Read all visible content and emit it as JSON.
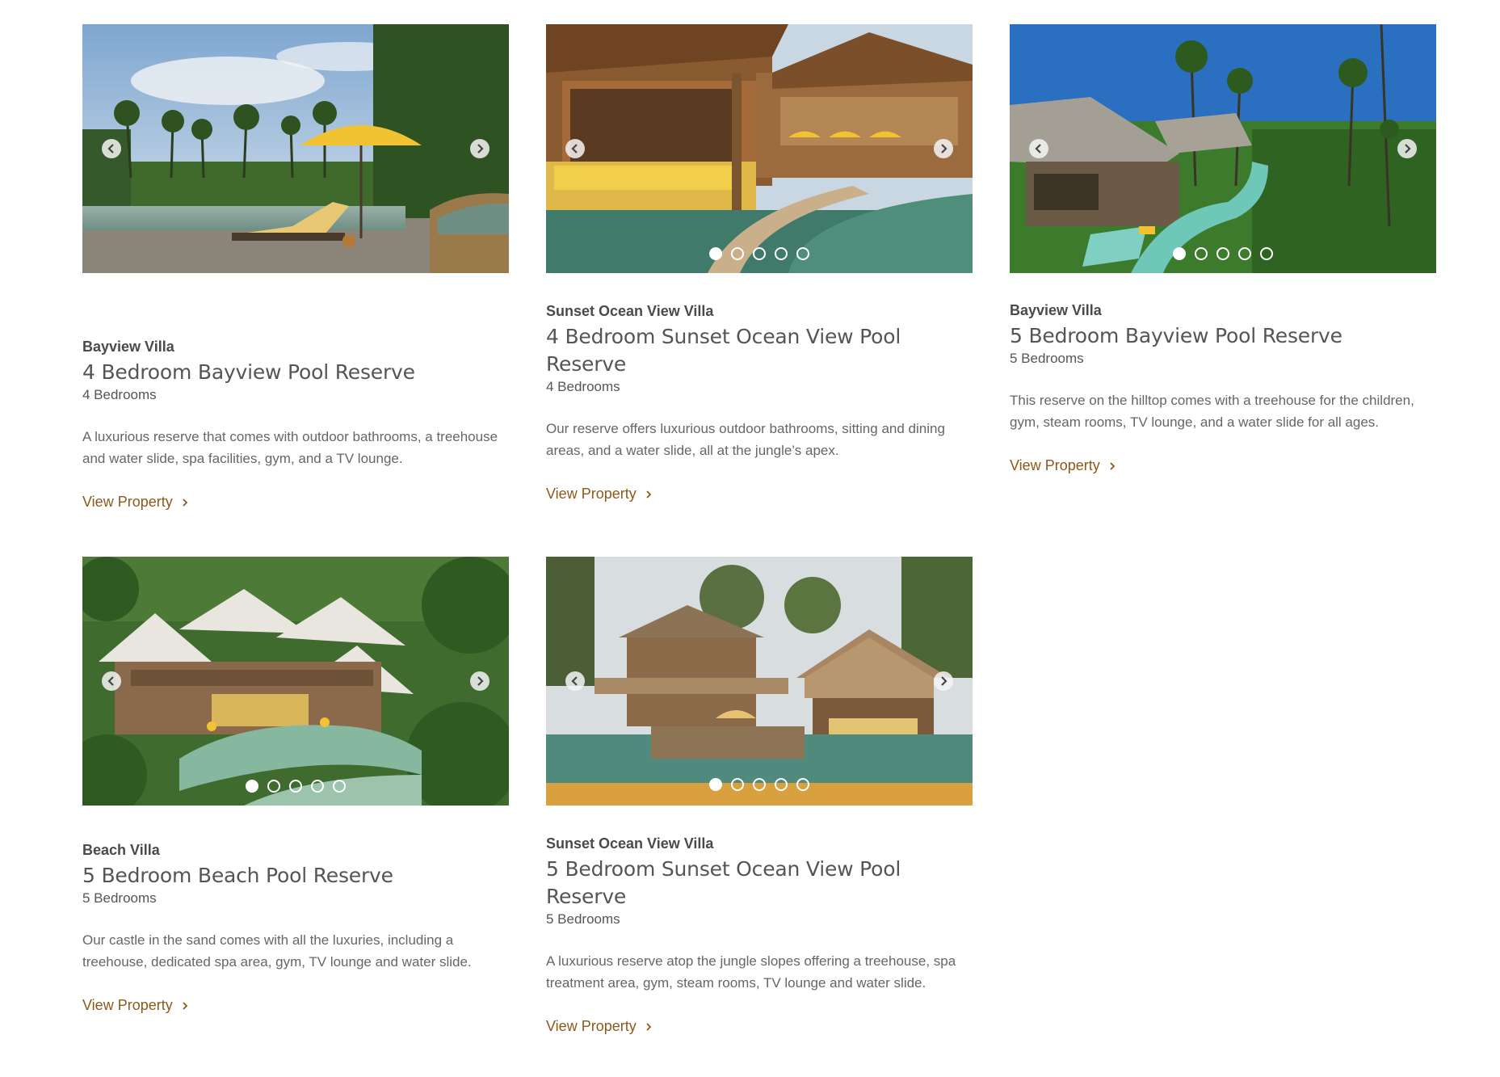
{
  "properties": [
    {
      "category": "Bayview Villa",
      "title": "4 Bedroom Bayview Pool Reserve",
      "bedrooms": "4 Bedrooms",
      "description": "A luxurious reserve that comes with outdoor bathrooms, a treehouse and water slide, spa facilities, gym, and a TV lounge.",
      "link": "View Property",
      "slide_count": 5,
      "active_slide": 1,
      "show_dots": false
    },
    {
      "category": "Sunset Ocean View Villa",
      "title": "4 Bedroom Sunset Ocean View Pool Reserve",
      "bedrooms": "4 Bedrooms",
      "description": "Our reserve offers luxurious outdoor bathrooms, sitting and dining areas, and a water slide, all at the jungle’s apex.",
      "link": "View Property",
      "slide_count": 5,
      "active_slide": 1,
      "show_dots": true
    },
    {
      "category": "Bayview Villa",
      "title": "5 Bedroom Bayview Pool Reserve",
      "bedrooms": "5 Bedrooms",
      "description": "This reserve on the hilltop comes with a treehouse for the children, gym, steam rooms, TV lounge, and a water slide for all ages.",
      "link": "View Property",
      "slide_count": 5,
      "active_slide": 1,
      "show_dots": true
    },
    {
      "category": "Beach Villa",
      "title": "5 Bedroom Beach Pool Reserve",
      "bedrooms": "5 Bedrooms",
      "description": "Our castle in the sand comes with all the luxuries, including a treehouse, dedicated spa area, gym, TV lounge and water slide.",
      "link": "View Property",
      "slide_count": 5,
      "active_slide": 1,
      "show_dots": true
    },
    {
      "category": "Sunset Ocean View Villa",
      "title": "5 Bedroom Sunset Ocean View Pool Reserve",
      "bedrooms": "5 Bedrooms",
      "description": "A luxurious reserve atop the jungle slopes offering a treehouse, spa treatment area, gym, steam rooms, TV lounge and water slide.",
      "link": "View Property",
      "slide_count": 5,
      "active_slide": 1,
      "show_dots": true
    }
  ],
  "icons": {
    "prev": "chevron-left-icon",
    "next": "chevron-right-icon",
    "link_arrow": "chevron-right-icon"
  },
  "colors": {
    "link": "#8b5a1a",
    "text": "#555555",
    "kicker": "#4a4a4a"
  }
}
